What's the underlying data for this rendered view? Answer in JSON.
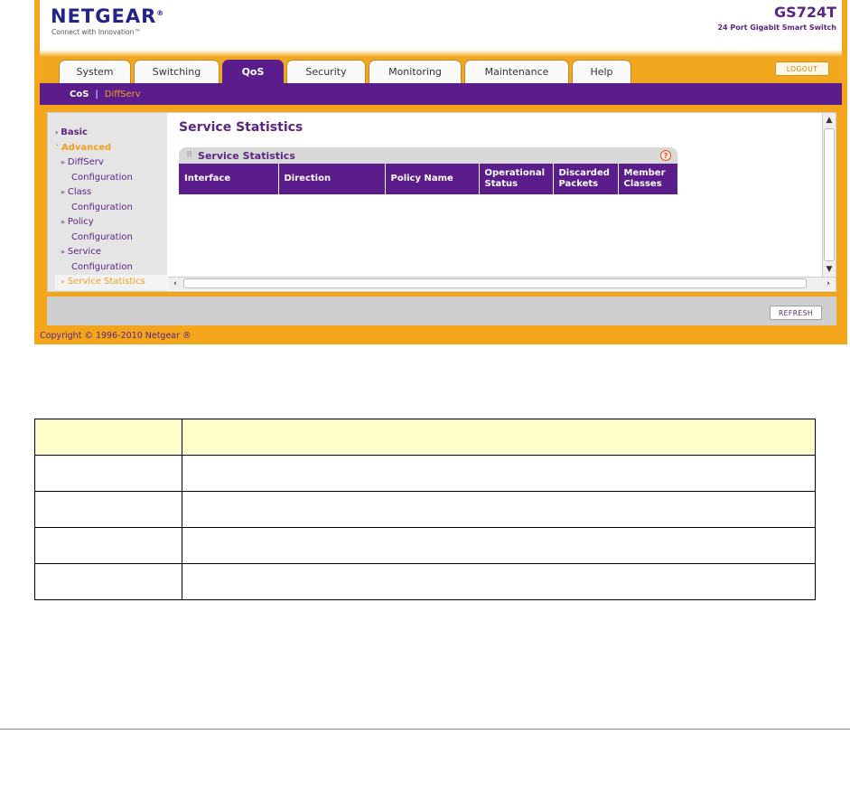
{
  "header": {
    "logo": "NETGEAR",
    "tagline": "Connect with Innovation™",
    "model": "GS724T",
    "model_desc": "24 Port Gigabit Smart Switch"
  },
  "tabs": [
    {
      "label": "System"
    },
    {
      "label": "Switching"
    },
    {
      "label": "QoS"
    },
    {
      "label": "Security"
    },
    {
      "label": "Monitoring"
    },
    {
      "label": "Maintenance"
    },
    {
      "label": "Help"
    }
  ],
  "active_tab": "QoS",
  "logout_label": "LOGOUT",
  "subnav": {
    "items": [
      "CoS",
      "DiffServ"
    ],
    "separator": "|",
    "current": "DiffServ"
  },
  "leftnav": {
    "basic": "Basic",
    "advanced": "Advanced",
    "items": [
      {
        "line1": "DiffServ",
        "line2": "Configuration"
      },
      {
        "line1": "Class",
        "line2": "Configuration"
      },
      {
        "line1": "Policy",
        "line2": "Configuration"
      },
      {
        "line1": "Service",
        "line2": "Configuration"
      }
    ],
    "current": "Service Statistics"
  },
  "page_title": "Service Statistics",
  "panel": {
    "title": "Service Statistics",
    "help_icon": "?",
    "columns": [
      {
        "l1": "Interface",
        "l2": ""
      },
      {
        "l1": "Direction",
        "l2": ""
      },
      {
        "l1": "Policy Name",
        "l2": ""
      },
      {
        "l1": "Operational",
        "l2": "Status"
      },
      {
        "l1": "Discarded",
        "l2": "Packets"
      },
      {
        "l1": "Member",
        "l2": "Classes"
      }
    ]
  },
  "refresh_label": "REFRESH",
  "copyright": "Copyright © 1996-2010 Netgear ®",
  "colors": {
    "orange_frame": "#f3a51c",
    "purple": "#5b1d8c",
    "doc_header_fill": "#fffec8"
  }
}
